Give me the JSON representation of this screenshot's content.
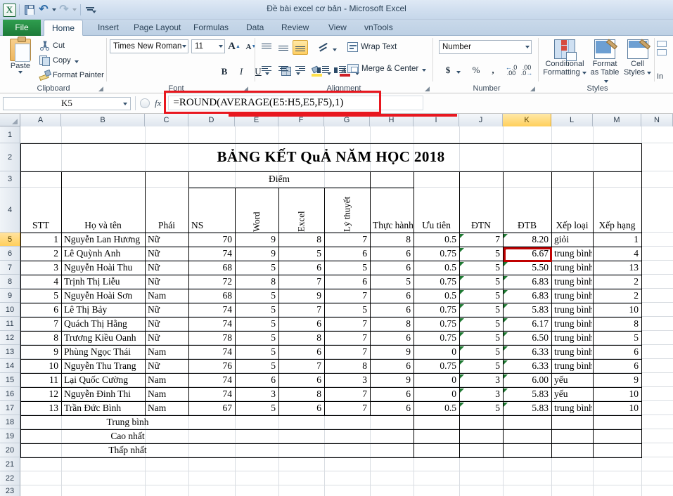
{
  "window": {
    "document_title": "Đề bài excel cơ bản",
    "app_name": "Microsoft Excel",
    "title_full": "Đề bài excel cơ bản  -  Microsoft Excel"
  },
  "quick_access": [
    {
      "name": "excel-logo-icon",
      "label": "X"
    },
    {
      "name": "save-icon",
      "label": "Save"
    },
    {
      "name": "undo-icon",
      "label": "Undo"
    },
    {
      "name": "redo-icon",
      "label": "Redo"
    },
    {
      "name": "customize-qat-icon",
      "label": "Customize Quick Access Toolbar"
    }
  ],
  "ribbon_tabs": [
    {
      "label": "File",
      "active": false
    },
    {
      "label": "Home",
      "active": true
    },
    {
      "label": "Insert",
      "active": false
    },
    {
      "label": "Page Layout",
      "active": false
    },
    {
      "label": "Formulas",
      "active": false
    },
    {
      "label": "Data",
      "active": false
    },
    {
      "label": "Review",
      "active": false
    },
    {
      "label": "View",
      "active": false
    },
    {
      "label": "vnTools",
      "active": false
    }
  ],
  "ribbon": {
    "clipboard": {
      "group_label": "Clipboard",
      "paste": "Paste",
      "cut": "Cut",
      "copy": "Copy",
      "format_painter": "Format Painter"
    },
    "font": {
      "group_label": "Font",
      "font_name": "Times New Roman",
      "font_size": "11",
      "bold": "B",
      "italic": "I",
      "underline": "U"
    },
    "alignment": {
      "group_label": "Alignment",
      "wrap_text": "Wrap Text",
      "merge_center": "Merge & Center"
    },
    "number": {
      "group_label": "Number",
      "format": "Number",
      "currency": "$",
      "percent": "%",
      "comma": ",",
      "decrease_decimal": ".00",
      "increase_decimal": ".00"
    },
    "styles": {
      "group_label": "Styles",
      "conditional_formatting": "Conditional\nFormatting",
      "conditional_formatting_l1": "Conditional",
      "conditional_formatting_l2": "Formatting",
      "format_as_table_l1": "Format",
      "format_as_table_l2": "as Table",
      "cell_styles_l1": "Cell",
      "cell_styles_l2": "Styles"
    },
    "cells": {
      "group_label": "",
      "insert_partial": "In"
    }
  },
  "formula_bar": {
    "name_box": "K5",
    "fx_label": "fx",
    "formula": "=ROUND(AVERAGE(E5:H5,E5,F5),1)"
  },
  "grid": {
    "columns": [
      "A",
      "B",
      "C",
      "D",
      "E",
      "F",
      "G",
      "H",
      "I",
      "J",
      "K",
      "L",
      "M",
      "N"
    ],
    "active_column": "K",
    "rows": [
      "1",
      "2",
      "3",
      "4",
      "5",
      "6",
      "7",
      "8",
      "9",
      "10",
      "11",
      "12",
      "13",
      "14",
      "15",
      "16",
      "17",
      "18",
      "19",
      "20",
      "21",
      "22",
      "23"
    ],
    "active_row": "5",
    "active_cell": "K5"
  },
  "sheet": {
    "title": "BẢNG KẾT QuẢ NĂM HỌC 2018",
    "group_header": "Điểm",
    "headers": {
      "stt": "STT",
      "name": "Họ và tên",
      "gender": "Phái",
      "ns": "NS",
      "word": "Word",
      "excel": "Excel",
      "theory": "Lý thuyết",
      "practice": "Thực hành",
      "priority": "Ưu tiên",
      "dtn": "ĐTN",
      "dtb": "ĐTB",
      "grade": "Xếp loại",
      "rank": "Xếp hạng"
    },
    "rows": [
      {
        "stt": "1",
        "name": "Nguyễn Lan Hương",
        "gender": "Nữ",
        "ns": "70",
        "word": "9",
        "excel": "8",
        "theory": "7",
        "practice": "8",
        "priority": "0.5",
        "dtn": "7",
        "dtb": "8.20",
        "grade": "giỏi",
        "rank": "1"
      },
      {
        "stt": "2",
        "name": "Lê Quỳnh Anh",
        "gender": "Nữ",
        "ns": "74",
        "word": "9",
        "excel": "5",
        "theory": "6",
        "practice": "6",
        "priority": "0.75",
        "dtn": "5",
        "dtb": "6.67",
        "grade": "trung bình",
        "rank": "4"
      },
      {
        "stt": "3",
        "name": "Nguyễn Hoài Thu",
        "gender": "Nữ",
        "ns": "68",
        "word": "5",
        "excel": "6",
        "theory": "5",
        "practice": "6",
        "priority": "0.5",
        "dtn": "5",
        "dtb": "5.50",
        "grade": "trung bình",
        "rank": "13"
      },
      {
        "stt": "4",
        "name": "Trịnh Thị Liễu",
        "gender": "Nữ",
        "ns": "72",
        "word": "8",
        "excel": "7",
        "theory": "6",
        "practice": "5",
        "priority": "0.75",
        "dtn": "5",
        "dtb": "6.83",
        "grade": "trung bình",
        "rank": "2"
      },
      {
        "stt": "5",
        "name": "Nguyễn Hoài Sơn",
        "gender": "Nam",
        "ns": "68",
        "word": "5",
        "excel": "9",
        "theory": "7",
        "practice": "6",
        "priority": "0.5",
        "dtn": "5",
        "dtb": "6.83",
        "grade": "trung bình",
        "rank": "2"
      },
      {
        "stt": "6",
        "name": "Lê Thị Bảy",
        "gender": "Nữ",
        "ns": "74",
        "word": "5",
        "excel": "7",
        "theory": "5",
        "practice": "6",
        "priority": "0.75",
        "dtn": "5",
        "dtb": "5.83",
        "grade": "trung bình",
        "rank": "10"
      },
      {
        "stt": "7",
        "name": "Quách Thị Hằng",
        "gender": "Nữ",
        "ns": "74",
        "word": "5",
        "excel": "6",
        "theory": "7",
        "practice": "8",
        "priority": "0.75",
        "dtn": "5",
        "dtb": "6.17",
        "grade": "trung bình",
        "rank": "8"
      },
      {
        "stt": "8",
        "name": "Trương Kiều Oanh",
        "gender": "Nữ",
        "ns": "78",
        "word": "5",
        "excel": "8",
        "theory": "7",
        "practice": "6",
        "priority": "0.75",
        "dtn": "5",
        "dtb": "6.50",
        "grade": "trung bình",
        "rank": "5"
      },
      {
        "stt": "9",
        "name": "Phùng Ngọc Thái",
        "gender": "Nam",
        "ns": "74",
        "word": "5",
        "excel": "6",
        "theory": "7",
        "practice": "9",
        "priority": "0",
        "dtn": "5",
        "dtb": "6.33",
        "grade": "trung bình",
        "rank": "6"
      },
      {
        "stt": "10",
        "name": "Nguyễn Thu Trang",
        "gender": "Nữ",
        "ns": "76",
        "word": "5",
        "excel": "7",
        "theory": "8",
        "practice": "6",
        "priority": "0.75",
        "dtn": "5",
        "dtb": "6.33",
        "grade": "trung bình",
        "rank": "6"
      },
      {
        "stt": "11",
        "name": "Lại Quốc Cường",
        "gender": "Nam",
        "ns": "74",
        "word": "6",
        "excel": "6",
        "theory": "3",
        "practice": "9",
        "priority": "0",
        "dtn": "3",
        "dtb": "6.00",
        "grade": "yếu",
        "rank": "9"
      },
      {
        "stt": "12",
        "name": "Nguyễn Đinh Thi",
        "gender": "Nam",
        "ns": "74",
        "word": "3",
        "excel": "8",
        "theory": "7",
        "practice": "6",
        "priority": "0",
        "dtn": "3",
        "dtb": "5.83",
        "grade": "yếu",
        "rank": "10"
      },
      {
        "stt": "13",
        "name": "Trần Đức Bình",
        "gender": "Nam",
        "ns": "67",
        "word": "5",
        "excel": "6",
        "theory": "7",
        "practice": "6",
        "priority": "0.5",
        "dtn": "5",
        "dtb": "5.83",
        "grade": "trung bình",
        "rank": "10"
      }
    ],
    "summary_rows": [
      {
        "label": "Trung bình"
      },
      {
        "label": "Cao nhất"
      },
      {
        "label": "Thấp nhất"
      }
    ]
  },
  "colors": {
    "selection_red": "#c00000",
    "highlight_red": "#e8171f",
    "active_header_yellow": "#ffcf5c",
    "excel_green": "#1c7a38",
    "error_flag_green": "#1f7a33"
  }
}
